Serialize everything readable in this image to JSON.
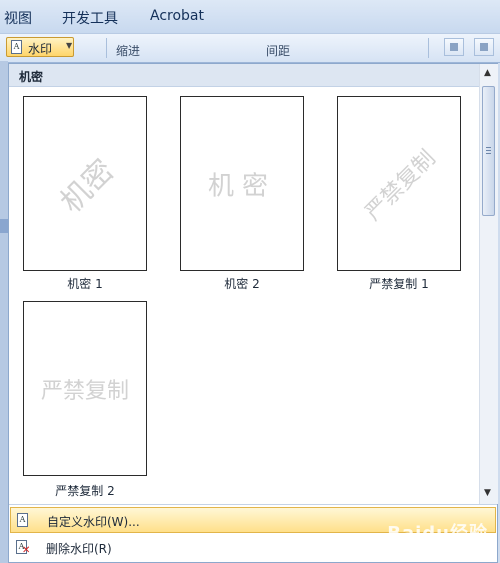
{
  "ribbon_tabs": [
    "视图",
    "开发工具",
    "Acrobat"
  ],
  "ribbon": {
    "watermark_button": "水印",
    "indent_label": "缩进",
    "spacing_label": "间距"
  },
  "gallery": {
    "section_title": "机密",
    "items": [
      {
        "caption": "机密 1",
        "watermark": "机密",
        "style": "diagonal"
      },
      {
        "caption": "机密 2",
        "watermark": "机密",
        "style": "horizontal"
      },
      {
        "caption": "严禁复制 1",
        "watermark": "严禁复制",
        "style": "diagonal"
      },
      {
        "caption": "严禁复制 2",
        "watermark": "严禁复制",
        "style": "horizontal"
      }
    ]
  },
  "menu": {
    "custom_watermark": "自定义水印(W)...",
    "remove_watermark": "删除水印(R)"
  },
  "site_watermark": {
    "logo": "Baidu经验",
    "url": "jingyan.baidu.com"
  },
  "icons": [
    "document-icon",
    "chevron-down-icon",
    "remove-watermark-icon",
    "scroll-up-icon",
    "scroll-down-icon"
  ],
  "colors": {
    "accent_hover": "#ffe08a",
    "ribbon_bg": "#cfdcee",
    "watermark_text": "#d2d2d2"
  }
}
